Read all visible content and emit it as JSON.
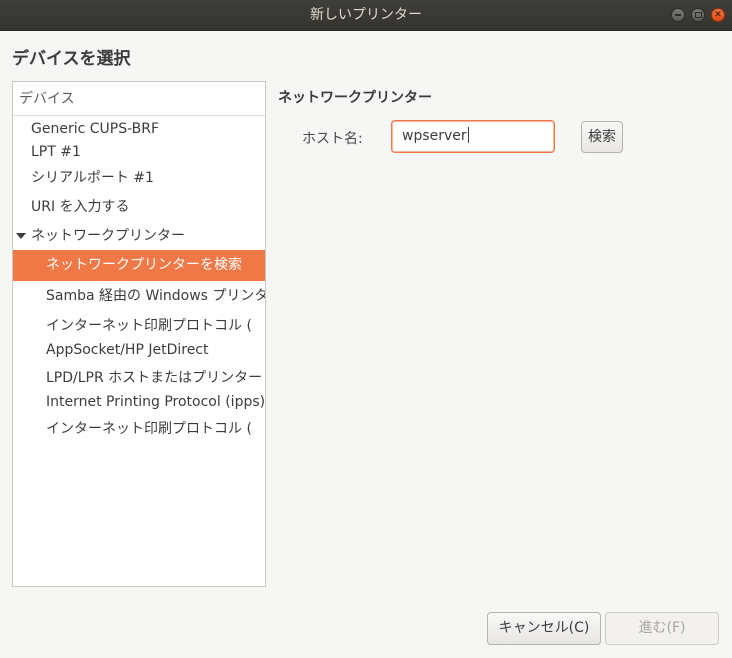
{
  "window": {
    "title": "新しいプリンター"
  },
  "page": {
    "heading": "デバイスを選択"
  },
  "devices": {
    "header": "デバイス",
    "items": [
      {
        "label": "Generic CUPS-BRF"
      },
      {
        "label": "LPT #1"
      },
      {
        "label": "シリアルポート #1"
      },
      {
        "label": "URI を入力する"
      },
      {
        "label": "ネットワークプリンター"
      },
      {
        "label": "ネットワークプリンターを検索"
      },
      {
        "label": "Samba 経由の Windows プリンター"
      },
      {
        "label": "インターネット印刷プロトコル ("
      },
      {
        "label": "AppSocket/HP JetDirect"
      },
      {
        "label": "LPD/LPR ホストまたはプリンター"
      },
      {
        "label": "Internet Printing Protocol (ipps)"
      },
      {
        "label": "インターネット印刷プロトコル ("
      }
    ],
    "selected": "ネットワークプリンターを検索",
    "expanded_group": "ネットワークプリンター"
  },
  "network_printer": {
    "heading": "ネットワークプリンター",
    "host_label": "ホスト名:",
    "host_value": "wpserver",
    "search_label": "検索"
  },
  "footer": {
    "cancel_label": "キャンセル(C)",
    "forward_label": "進む(F)",
    "forward_enabled": false
  },
  "colors": {
    "accent": "#f07746",
    "titlebar": "#3a3935",
    "window_bg": "#f6f6f5"
  }
}
